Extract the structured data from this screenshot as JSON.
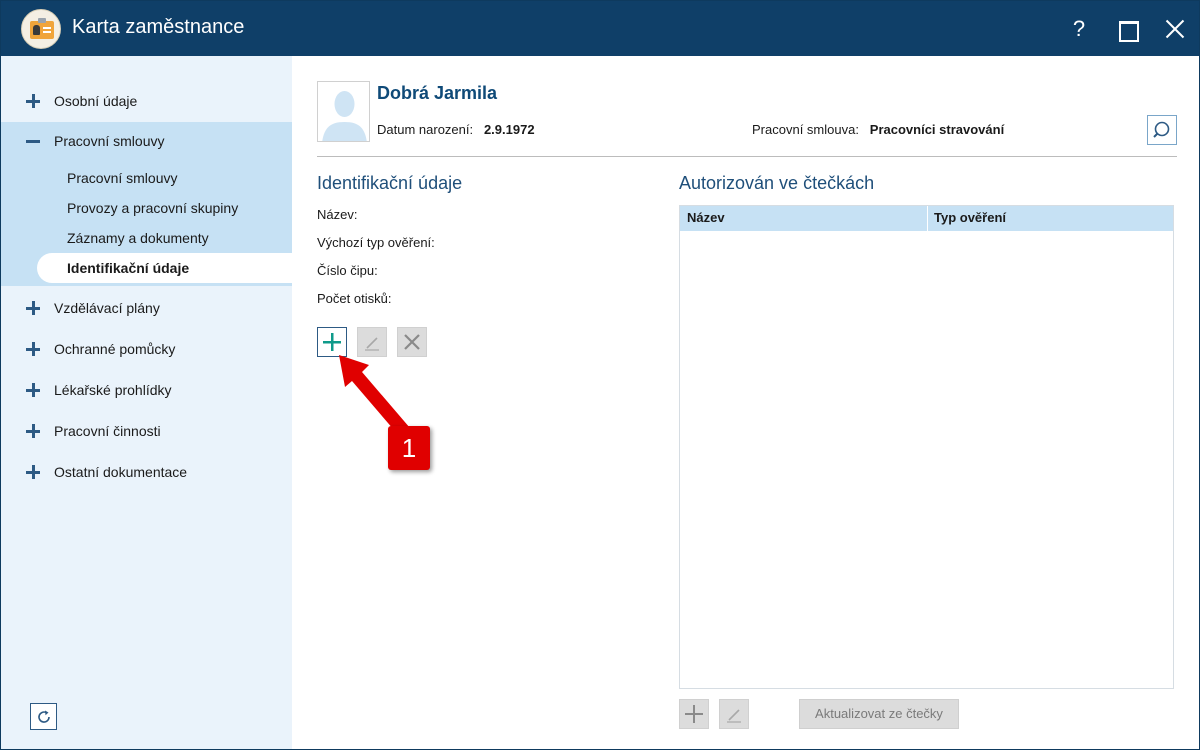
{
  "window": {
    "title": "Karta zaměstnance"
  },
  "titlebar": {
    "help_label": "?"
  },
  "sidebar": {
    "items": [
      {
        "label": "Osobní údaje",
        "expanded": false
      },
      {
        "label": "Pracovní smlouvy",
        "expanded": true
      },
      {
        "label": "Vzdělávací plány",
        "expanded": false
      },
      {
        "label": "Ochranné pomůcky",
        "expanded": false
      },
      {
        "label": "Lékařské prohlídky",
        "expanded": false
      },
      {
        "label": "Pracovní činnosti",
        "expanded": false
      },
      {
        "label": "Ostatní dokumentace",
        "expanded": false
      }
    ],
    "subitems": [
      {
        "label": "Pracovní smlouvy"
      },
      {
        "label": "Provozy a pracovní skupiny"
      },
      {
        "label": "Záznamy a dokumenty"
      },
      {
        "label": "Identifikační údaje",
        "active": true
      }
    ]
  },
  "header": {
    "name": "Dobrá Jarmila",
    "birth_label": "Datum narození:",
    "birth_value": "2.9.1972",
    "contract_label": "Pracovní smlouva:",
    "contract_value": "Pracovníci stravování"
  },
  "identification": {
    "title": "Identifikační údaje",
    "fields": [
      "Název:",
      "Výchozí typ ověření:",
      "Číslo čipu:",
      "Počet otisků:"
    ]
  },
  "readers": {
    "title": "Autorizován ve čtečkách",
    "columns": [
      "Název",
      "Typ ověření"
    ],
    "rows": [],
    "update_button_label": "Aktualizovat ze čtečky"
  },
  "annotation": {
    "badge": "1"
  },
  "colors": {
    "titlebar": "#0f3f68",
    "sidebar": "#eaf3fb",
    "accent_selected": "#c6e1f4",
    "callout": "#e00000"
  }
}
